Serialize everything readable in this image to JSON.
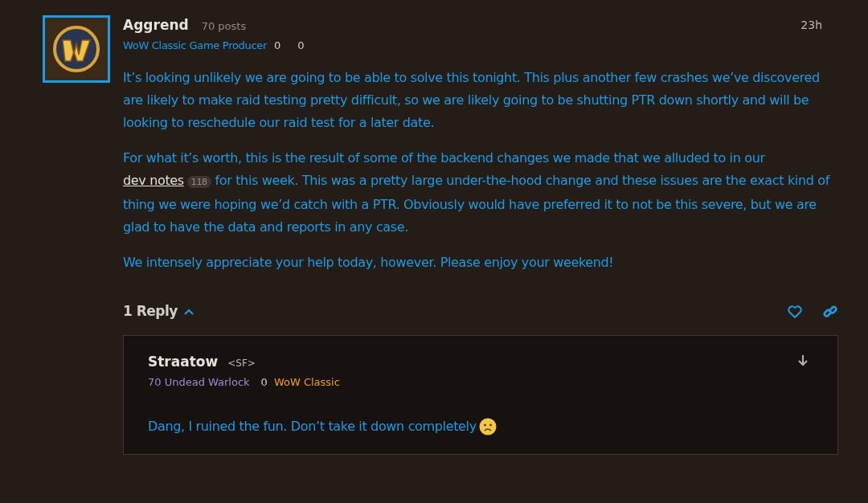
{
  "post": {
    "author": "Aggrend",
    "post_count": "70 posts",
    "title": "WoW Classic Game Producer",
    "stat_1": "0",
    "stat_2": "0",
    "time": "23h",
    "paragraphs": [
      [
        {
          "kind": "text",
          "text": "It’s looking unlikely we are going to be able to solve this tonight. This plus another few crashes we’ve discovered are likely to make raid testing pretty difficult, so we are likely going to be shutting PTR down shortly and will be looking to reschedule our raid test for a later date."
        }
      ],
      [
        {
          "kind": "text",
          "text": "For what it’s worth, this is the result of some of the backend changes we made that we alluded to in our "
        },
        {
          "kind": "link",
          "text": "dev notes"
        },
        {
          "kind": "badge",
          "text": "118"
        },
        {
          "kind": "text",
          "text": " for this week. This was a pretty large under-the-hood change and these issues are the exact kind of thing we were hoping we’d catch with a PTR. Obviously would have preferred it to not be this severe, but we are glad to have the data and reports in any case."
        }
      ],
      [
        {
          "kind": "text",
          "text": "We intensely appreciate your help today, however. Please enjoy your weekend!"
        }
      ]
    ],
    "replies_label": "1 Reply",
    "replies_expanded": true
  },
  "reply": {
    "author": "Straatow",
    "guild": "<SF>",
    "character": "70 Undead Warlock",
    "stat": "0",
    "game": "WoW Classic",
    "text": "Dang, I ruined the fun. Don’t take it down completely",
    "emoji": true
  }
}
